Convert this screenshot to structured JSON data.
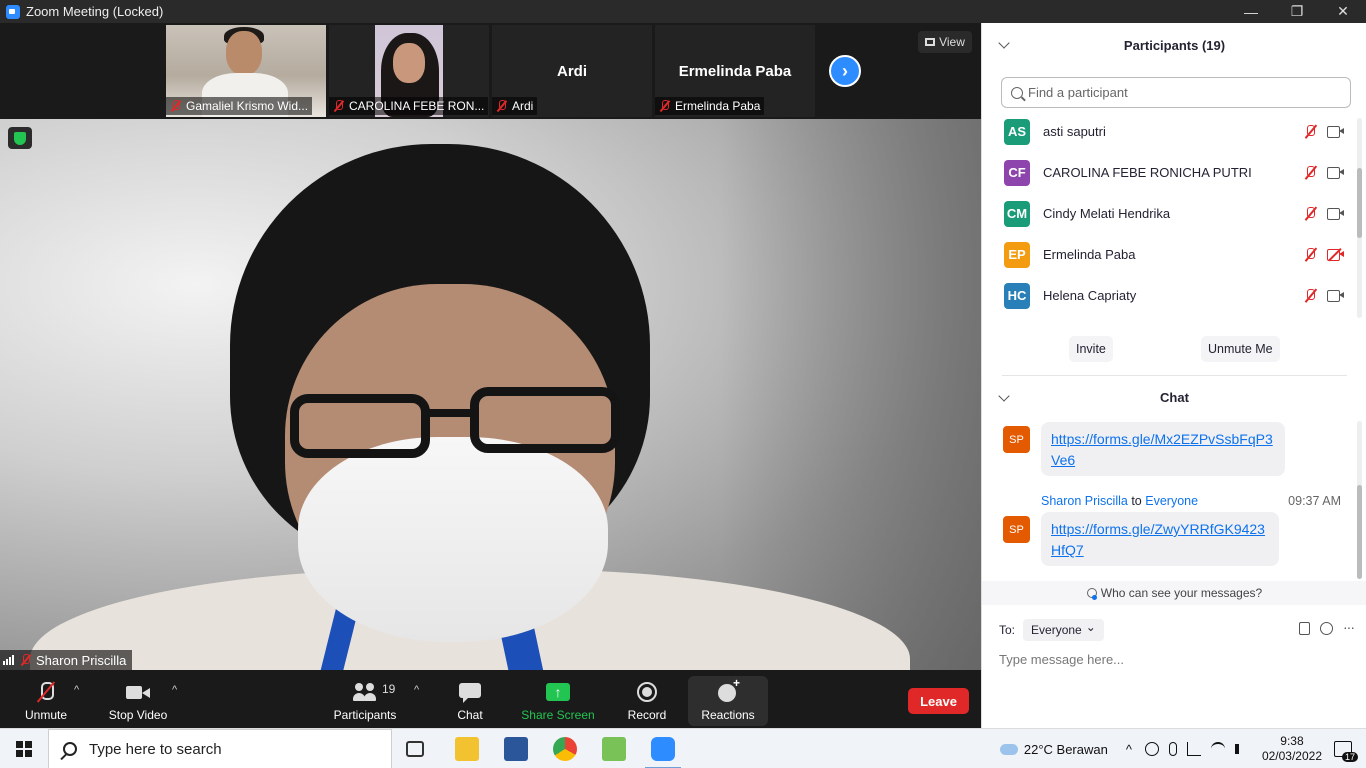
{
  "window": {
    "title": "Zoom Meeting (Locked)",
    "controls": {
      "minimize": "—",
      "restore": "❐",
      "close": "✕"
    }
  },
  "gallery": {
    "thumbnails": [
      {
        "name": "Gamaliel Krismo Wid...",
        "has_video": true
      },
      {
        "name": "CAROLINA FEBE RON...",
        "has_video": true
      },
      {
        "name": "Ardi",
        "big_name": "Ardi",
        "has_video": false
      },
      {
        "name": "Ermelinda Paba",
        "big_name": "Ermelinda Paba",
        "has_video": false
      }
    ],
    "next_glyph": "›",
    "view_label": "View"
  },
  "main_video": {
    "speaker_name": "Sharon Priscilla"
  },
  "toolbar": {
    "unmute": "Unmute",
    "stop_video": "Stop Video",
    "participants": "Participants",
    "participants_count": "19",
    "chat": "Chat",
    "share_screen": "Share Screen",
    "record": "Record",
    "reactions": "Reactions",
    "leave": "Leave",
    "caret": "^",
    "colors": {
      "leave": "#e02828",
      "share": "#23c552"
    }
  },
  "participants_panel": {
    "title": "Participants (19)",
    "search_placeholder": "Find a participant",
    "items": [
      {
        "initials": "AS",
        "name": "asti saputri",
        "color": "#1a9c79",
        "video_off": false
      },
      {
        "initials": "CF",
        "name": "CAROLINA FEBE RONICHA PUTRI",
        "color": "#8e44ad",
        "video_off": false
      },
      {
        "initials": "CM",
        "name": "Cindy Melati Hendrika",
        "color": "#1a9c79",
        "video_off": false
      },
      {
        "initials": "EP",
        "name": "Ermelinda Paba",
        "color": "#f39c12",
        "video_off": true
      },
      {
        "initials": "HC",
        "name": "Helena Capriaty",
        "color": "#2980b9",
        "video_off": false
      }
    ],
    "invite": "Invite",
    "unmute_me": "Unmute Me"
  },
  "chat_panel": {
    "title": "Chat",
    "messages": [
      {
        "avatar": "SP",
        "text": "https://forms.gle/Mx2EZPvSsbFqP3Ve6"
      },
      {
        "avatar": "SP",
        "sender": "Sharon Priscilla",
        "to_word": "to",
        "recipient": "Everyone",
        "time": "09:37 AM",
        "text": "https://forms.gle/ZwyYRRfGK9423HfQ7"
      }
    ],
    "who_can_see": "Who can see your messages?",
    "to_label": "To:",
    "to_value": "Everyone",
    "more": "···",
    "input_placeholder": "Type message here..."
  },
  "taskbar": {
    "search_placeholder": "Type here to search",
    "weather": "22°C  Berawan",
    "time": "9:38",
    "date": "02/03/2022",
    "notifications": "17",
    "chevron": "^"
  }
}
